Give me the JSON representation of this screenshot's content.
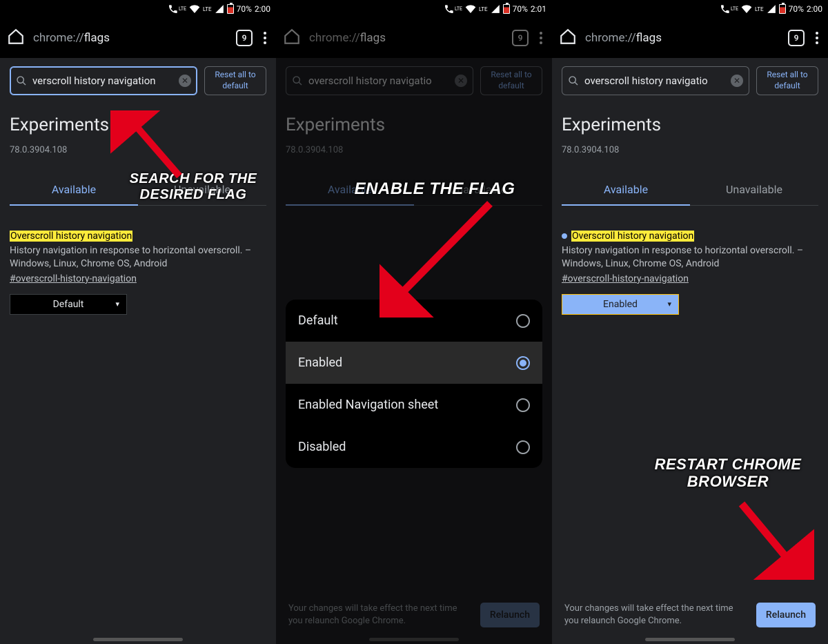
{
  "status": {
    "battery": "70%",
    "time1": "2:00",
    "time2": "2:01",
    "time3": "2:00"
  },
  "omni": {
    "prefix": "chrome://",
    "page": "flags",
    "tabcount": "9"
  },
  "search": {
    "value1": "verscroll history navigation",
    "value2": "overscroll history navigatio",
    "reset": "Reset all to default"
  },
  "page": {
    "title": "Experiments",
    "version": "78.0.3904.108",
    "tab_avail": "Available",
    "tab_unavail": "Unavailable"
  },
  "flag": {
    "name": "Overscroll history navigation",
    "desc": "History navigation in response to horizontal overscroll. – Windows, Linux, Chrome OS, Android",
    "hash": "#overscroll-history-navigation",
    "sel_default": "Default",
    "sel_enabled": "Enabled"
  },
  "popup": {
    "o1": "Default",
    "o2": "Enabled",
    "o3": "Enabled Navigation sheet",
    "o4": "Disabled"
  },
  "footer": {
    "msg": "Your changes will take effect the next time you relaunch Google Chrome.",
    "btn": "Relaunch"
  },
  "captions": {
    "c1": "SEARCH FOR THE DESIRED FLAG",
    "c2": "ENABLE THE FLAG",
    "c3": "RESTART CHROME BROWSER"
  }
}
